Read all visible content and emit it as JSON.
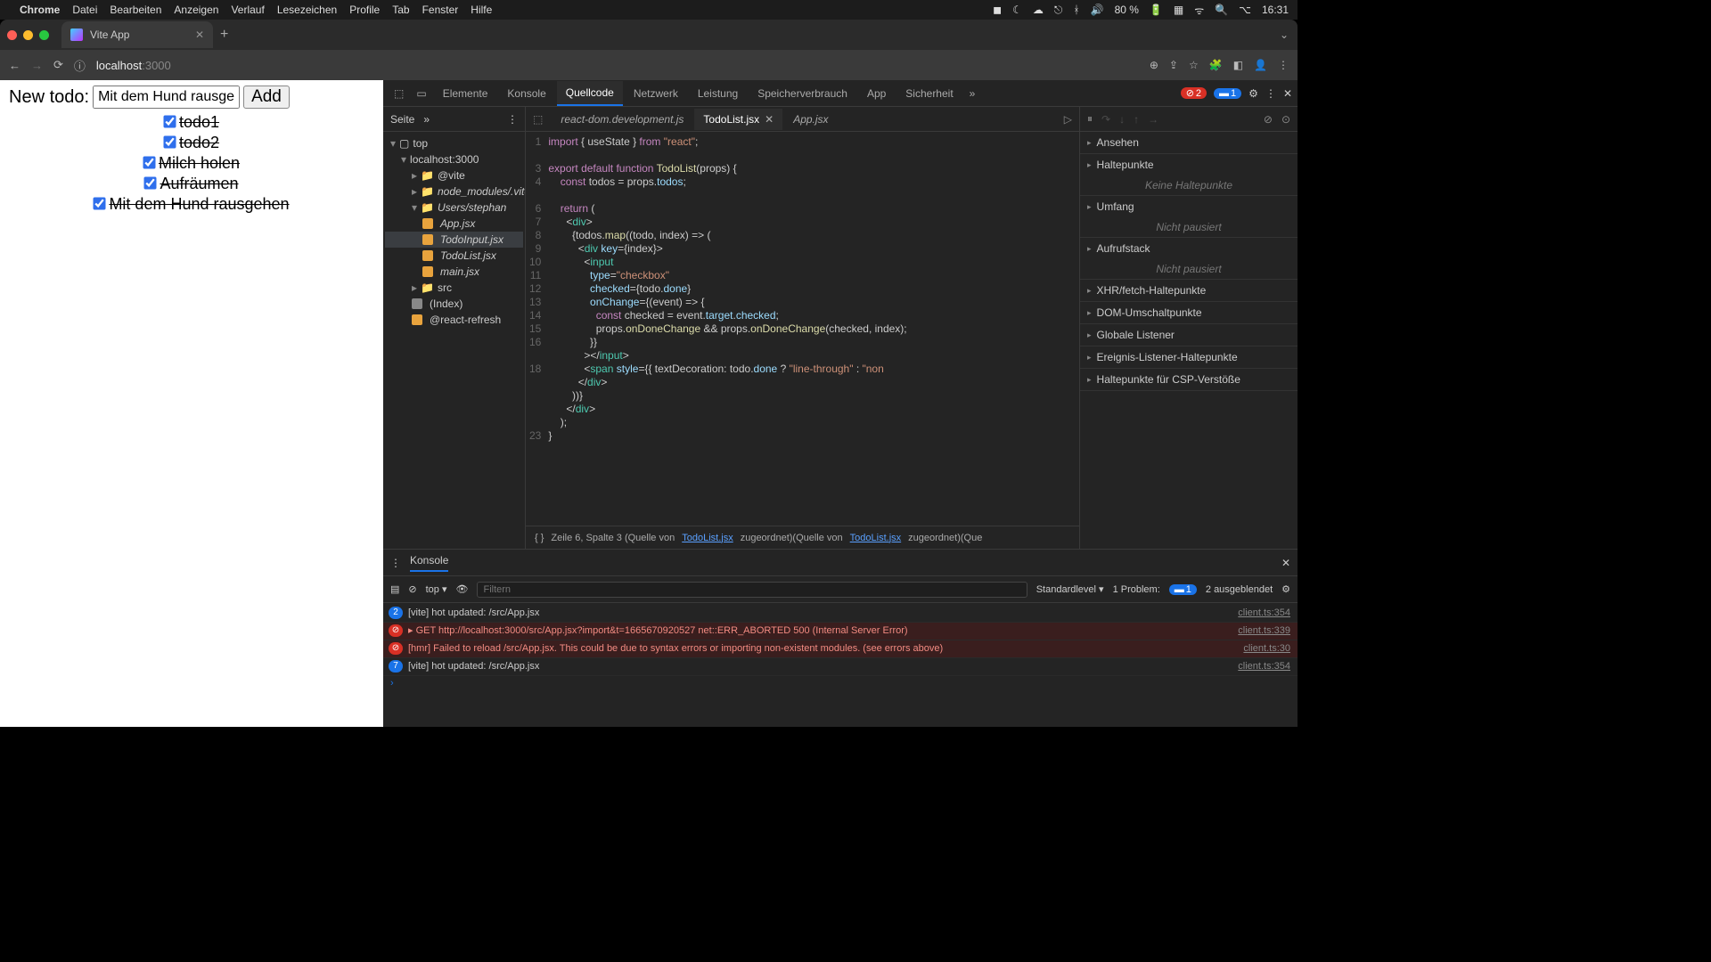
{
  "menubar": {
    "app": "Chrome",
    "items": [
      "Datei",
      "Bearbeiten",
      "Anzeigen",
      "Verlauf",
      "Lesezeichen",
      "Profile",
      "Tab",
      "Fenster",
      "Hilfe"
    ],
    "battery": "80 %",
    "clock": "16:31"
  },
  "browser": {
    "tab_title": "Vite App",
    "new_tab": "+",
    "url_host": "localhost",
    "url_path": ":3000"
  },
  "todo_app": {
    "label": "New todo:",
    "input": "Mit dem Hund rausgehe",
    "add": "Add",
    "todos": [
      {
        "text": "todo1",
        "done": true
      },
      {
        "text": "todo2",
        "done": true
      },
      {
        "text": "Milch holen",
        "done": true
      },
      {
        "text": "Aufräumen",
        "done": true
      },
      {
        "text": "Mit dem Hund rausgehen",
        "done": true
      }
    ]
  },
  "devtools": {
    "tabs": [
      "Elemente",
      "Konsole",
      "Quellcode",
      "Netzwerk",
      "Leistung",
      "Speicherverbrauch",
      "App",
      "Sicherheit"
    ],
    "active_tab": "Quellcode",
    "err_count": "2",
    "issue_count": "1",
    "sources_header": "Seite",
    "tree": {
      "top": "top",
      "host": "localhost:3000",
      "vite": "@vite",
      "node": "node_modules/.vite/deps",
      "users": "Users/stephan",
      "files": [
        "App.jsx",
        "TodoInput.jsx",
        "TodoList.jsx",
        "main.jsx"
      ],
      "src": "src",
      "index": "(Index)",
      "refresh": "@react-refresh"
    },
    "open_files": [
      "react-dom.development.js",
      "TodoList.jsx",
      "App.jsx"
    ],
    "active_file": "TodoList.jsx",
    "status": {
      "pre": "Zeile 6, Spalte 3  (Quelle von ",
      "link": "TodoList.jsx",
      "mid": " zugeordnet)(Quelle von ",
      "link2": "TodoList.jsx",
      "post": " zugeordnet)(Que"
    },
    "debug_panels": [
      "Ansehen",
      "Haltepunkte",
      "Umfang",
      "Aufrufstack",
      "XHR/fetch-Haltepunkte",
      "DOM-Umschaltpunkte",
      "Globale Listener",
      "Ereignis-Listener-Haltepunkte",
      "Haltepunkte für CSP-Verstöße"
    ],
    "debug_msgs": {
      "no_bp": "Keine Haltepunkte",
      "not_paused": "Nicht pausiert",
      "not_paused2": "Nicht pausiert"
    }
  },
  "console": {
    "title": "Konsole",
    "ctx": "top",
    "filter_placeholder": "Filtern",
    "level": "Standardlevel",
    "problems_lbl": "1 Problem:",
    "problems_cnt": "1",
    "hidden": "2 ausgeblendet",
    "logs": [
      {
        "type": "info",
        "count": "2",
        "text": "[vite] hot updated: /src/App.jsx",
        "src": "client.ts:354"
      },
      {
        "type": "err",
        "count": "",
        "text": "▸ GET http://localhost:3000/src/App.jsx?import&t=1665670920527 net::ERR_ABORTED 500 (Internal Server Error)",
        "src": "client.ts:339"
      },
      {
        "type": "err",
        "count": "",
        "text": "[hmr] Failed to reload /src/App.jsx. This could be due to syntax errors or importing non-existent modules. (see errors above)",
        "src": "client.ts:30"
      },
      {
        "type": "info",
        "count": "7",
        "text": "[vite] hot updated: /src/App.jsx",
        "src": "client.ts:354"
      }
    ]
  }
}
